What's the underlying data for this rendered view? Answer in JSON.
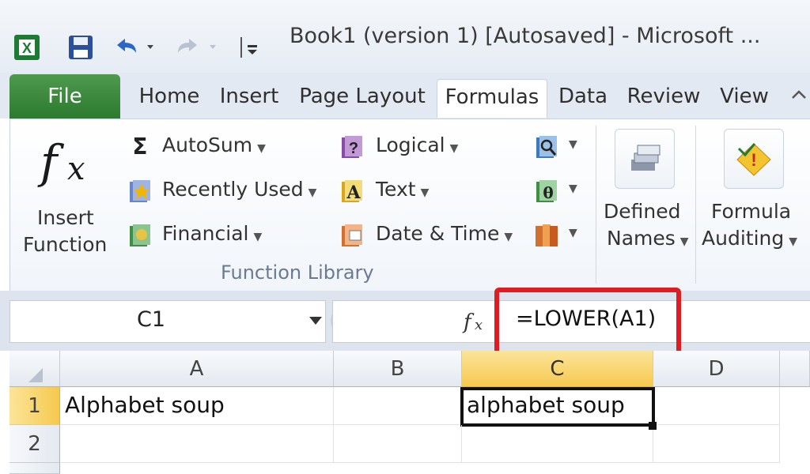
{
  "window": {
    "title": "Book1 (version 1) [Autosaved]  -  Microsoft ..."
  },
  "quick_access": [
    "excel-logo-icon",
    "save-icon",
    "undo-icon",
    "redo-icon",
    "customize-icon"
  ],
  "tabs": [
    {
      "label": "File"
    },
    {
      "label": "Home"
    },
    {
      "label": "Insert"
    },
    {
      "label": "Page Layout"
    },
    {
      "label": "Formulas",
      "active": true
    },
    {
      "label": "Data"
    },
    {
      "label": "Review"
    },
    {
      "label": "View"
    }
  ],
  "ribbon": {
    "insert_function": {
      "line1": "Insert",
      "line2": "Function",
      "icon": "fx-icon"
    },
    "autosum": "AutoSum",
    "recently_used": "Recently Used",
    "financial": "Financial",
    "logical": "Logical",
    "text": "Text",
    "date_time": "Date & Time",
    "defined_names": {
      "line1": "Defined",
      "line2": "Names"
    },
    "formula_auditing": {
      "line1": "Formula",
      "line2": "Auditing"
    },
    "group_label": "Function Library"
  },
  "formula_bar": {
    "name_box": "C1",
    "fx_label": "fx",
    "formula": "=LOWER(A1)"
  },
  "grid": {
    "columns": [
      "A",
      "B",
      "C",
      "D"
    ],
    "rows": [
      "1",
      "2"
    ],
    "cells": {
      "A1": "Alphabet soup",
      "C1": "alphabet soup"
    },
    "selected_cell": "C1"
  },
  "colors": {
    "file_tab": "#2c7a2e",
    "highlight": "#e11b22",
    "selected_header": "#f6c94e"
  }
}
